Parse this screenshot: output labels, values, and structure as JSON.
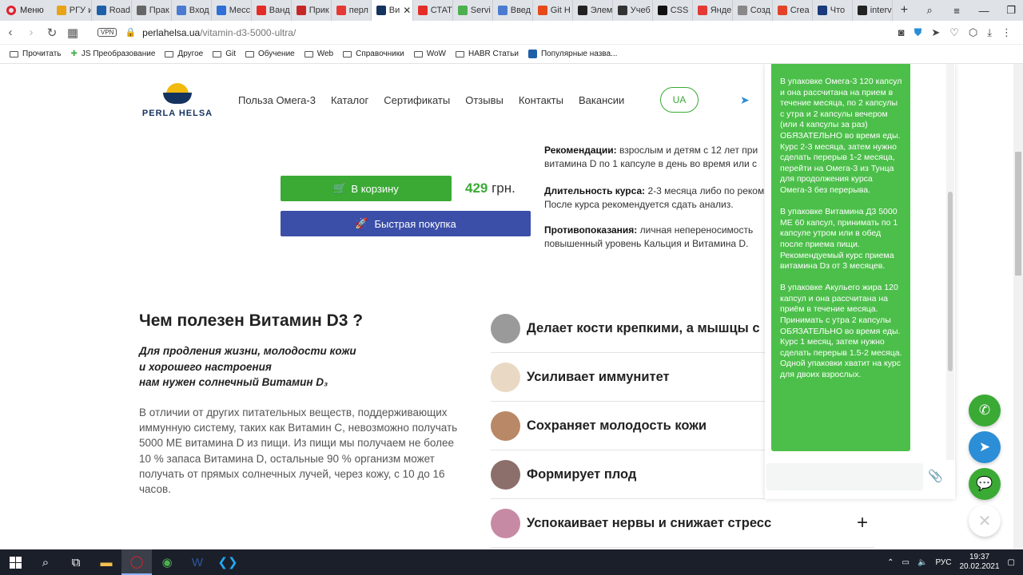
{
  "browser": {
    "menu_label": "Меню",
    "tabs": [
      {
        "label": "РГУ и",
        "color": "#e8a317"
      },
      {
        "label": "Road",
        "color": "#1f5fa8"
      },
      {
        "label": "Прак",
        "color": "#666666"
      },
      {
        "label": "Вход",
        "color": "#4a7bd0"
      },
      {
        "label": "Месс",
        "color": "#2f6fd6"
      },
      {
        "label": "Ванд",
        "color": "#e52d27"
      },
      {
        "label": "Прик",
        "color": "#c62828"
      },
      {
        "label": "перл",
        "color": "#e53935"
      },
      {
        "label": "Ви",
        "color": "#15335f",
        "active": true
      },
      {
        "label": "СТАТ",
        "color": "#e52d27"
      },
      {
        "label": "Servi",
        "color": "#4caf50"
      },
      {
        "label": "Введ",
        "color": "#4a7bd0"
      },
      {
        "label": "Git H",
        "color": "#e64a19"
      },
      {
        "label": "Элем",
        "color": "#222222"
      },
      {
        "label": "Учеб",
        "color": "#333333"
      },
      {
        "label": "CSS",
        "color": "#111111"
      },
      {
        "label": "Янде",
        "color": "#e53935"
      },
      {
        "label": "Созд",
        "color": "#888888"
      },
      {
        "label": "Crea",
        "color": "#e24329"
      },
      {
        "label": "Что",
        "color": "#1a3a7a"
      },
      {
        "label": "interv",
        "color": "#222222"
      }
    ],
    "new_tab": "+",
    "url_host": "perlahelsa.ua",
    "url_path": "/vitamin-d3-5000-ultra/",
    "vpn": "VPN",
    "bookmarks": [
      {
        "label": "Прочитать",
        "icon": "folder-icon"
      },
      {
        "label": "JS Преобразование",
        "icon": "puzzle-icon"
      },
      {
        "label": "Другое",
        "icon": "folder-icon"
      },
      {
        "label": "Git",
        "icon": "folder-icon"
      },
      {
        "label": "Обучение",
        "icon": "folder-icon"
      },
      {
        "label": "Web",
        "icon": "folder-icon"
      },
      {
        "label": "Справочники",
        "icon": "folder-icon"
      },
      {
        "label": "WoW",
        "icon": "folder-icon"
      },
      {
        "label": "HABR Статьи",
        "icon": "folder-icon"
      },
      {
        "label": "Популярные назва...",
        "icon": "trello-icon"
      }
    ]
  },
  "site": {
    "logo_text": "PERLA HELSA",
    "nav": [
      "Польза Омега-3",
      "Каталог",
      "Сертификаты",
      "Отзывы",
      "Контакты",
      "Вакансии"
    ],
    "lang": "UA",
    "cart_button": "В корзину",
    "price_value": "429",
    "price_currency": "грн.",
    "quick_buy": "Быстрая покупка",
    "reco_label": "Рекомендации:",
    "reco_text_1": " взрослым и детям с 12 лет при",
    "reco_text_2": "витамина D по 1 капсуле в день во время или с",
    "course_label": "Длительность курса:",
    "course_text_1": " 2-3 месяца либо по реком",
    "course_text_2": "После курса рекомендуется сдать анализ.",
    "contra_label": "Противопоказания:",
    "contra_text_1": " личная непереносимость",
    "contra_text_2": "повышенный уровень Кальция и Витамина D.",
    "benefit_heading": "Чем полезен Витамин D3 ?",
    "benefit_sub_1": "Для продления жизни, молодости кожи",
    "benefit_sub_2": "и хорошего настроения",
    "benefit_sub_3": "нам нужен солнечный Витамин D₃",
    "benefit_body": "В отличии от других питательных веществ, поддерживающих иммунную систему, таких как Витамин С, невозможно получать 5000 МЕ витамина D из пищи. Из пищи мы получаем не более 10 % запаса Витамина D, остальные 90 % организм может получать от прямых солнечных лучей, через кожу, с 10 до 16 часов.",
    "features": [
      {
        "label": "Делает кости крепкими, а мышцы с",
        "color": "#9a9a9a"
      },
      {
        "label": "Усиливает иммунитет",
        "color": "#e9d9c4"
      },
      {
        "label": "Сохраняет молодость кожи",
        "color": "#b98867"
      },
      {
        "label": "Формирует плод",
        "color": "#8c6f6a"
      },
      {
        "label": "Успокаивает нервы и снижает стресс",
        "color": "#c78aa4"
      }
    ],
    "plus": "+"
  },
  "chat": {
    "message": "В упаковке Омега-3 120 капсул и она рассчитана на прием в течение месяца, по 2 капсулы с утра и 2 капсулы вечером (или 4 капсулы  за раз) ОБЯЗАТЕЛЬНО во время еды. Курс 2-3 месяца, затем нужно сделать перерыв 1-2 месяца, перейти на Омега-3 из Тунца для продолжения курса Омега-3 без перерыва.\n\nВ упаковке Витамина Д3 5000 МЕ 60 капсул, принимать по 1 капсуле утром или в обед после приема пищи. Рекомендуемый курс приема витамина Dз от 3 месяцев.\n\nВ упаковке Акульего жира 120 капсул и она рассчитана на приём в течение месяца. Принимать с утра 2 капсулы ОБЯЗАТЕЛЬНО во время еды. Курс 1 месяц, затем нужно сделать перерыв 1.5-2 месяца. Одной упаковки хватит на курс для двоих взрослых.",
    "input_value": ""
  },
  "taskbar": {
    "lang": "РУС",
    "time": "19:37",
    "date": "20.02.2021"
  },
  "colors": {
    "accent_green": "#3aaa35",
    "quick_blue": "#3b4ea8",
    "brand_navy": "#15335f"
  }
}
